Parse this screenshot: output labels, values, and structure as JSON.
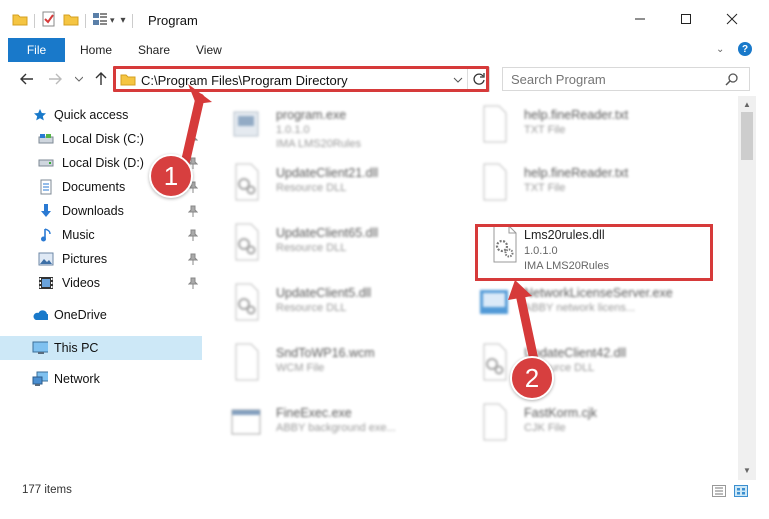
{
  "window": {
    "title": "Program",
    "minimize": "—",
    "maximize": "☐",
    "close": "✕"
  },
  "ribbon": {
    "file": "File",
    "tabs": [
      "Home",
      "Share",
      "View"
    ]
  },
  "address": {
    "path": "C:\\Program Files\\Program Directory"
  },
  "search": {
    "placeholder": "Search Program"
  },
  "sidebar": {
    "quick_access": "Quick access",
    "items": [
      {
        "label": "Local Disk (C:)",
        "icon": "drive-icon"
      },
      {
        "label": "Local Disk (D:)",
        "icon": "drive-icon"
      },
      {
        "label": "Documents",
        "icon": "documents-icon"
      },
      {
        "label": "Downloads",
        "icon": "downloads-icon"
      },
      {
        "label": "Music",
        "icon": "music-icon"
      },
      {
        "label": "Pictures",
        "icon": "pictures-icon"
      },
      {
        "label": "Videos",
        "icon": "videos-icon"
      }
    ],
    "onedrive": "OneDrive",
    "this_pc": "This PC",
    "network": "Network"
  },
  "files": [
    {
      "name": "program.exe",
      "line2": "1.0.1.0",
      "line3": "IMA LMS20Rules"
    },
    {
      "name": "help.fineReader.txt",
      "line2": "TXT File",
      "line3": ""
    },
    {
      "name": "UpdateClient21.dll",
      "line2": "Resource DLL",
      "line3": ""
    },
    {
      "name": "help.fineReader.txt",
      "line2": "TXT File",
      "line3": ""
    },
    {
      "name": "UpdateClient65.dll",
      "line2": "Resource DLL",
      "line3": ""
    },
    {
      "name": "Lms20rules.dll",
      "line2": "1.0.1.0",
      "line3": "IMA LMS20Rules"
    },
    {
      "name": "UpdateClient5.dll",
      "line2": "Resource DLL",
      "line3": ""
    },
    {
      "name": "NetworkLicenseServer.exe",
      "line2": "ABBY network licens...",
      "line3": ""
    },
    {
      "name": "SndToWP16.wcm",
      "line2": "WCM File",
      "line3": ""
    },
    {
      "name": "UpdateClient42.dll",
      "line2": "Resource DLL",
      "line3": ""
    },
    {
      "name": "FineExec.exe",
      "line2": "ABBY background exe...",
      "line3": ""
    },
    {
      "name": "FastKorm.cjk",
      "line2": "CJK File",
      "line3": ""
    }
  ],
  "status": {
    "count": "177 items"
  },
  "annotations": {
    "step1": "1",
    "step2": "2",
    "color": "#d63a3a"
  }
}
